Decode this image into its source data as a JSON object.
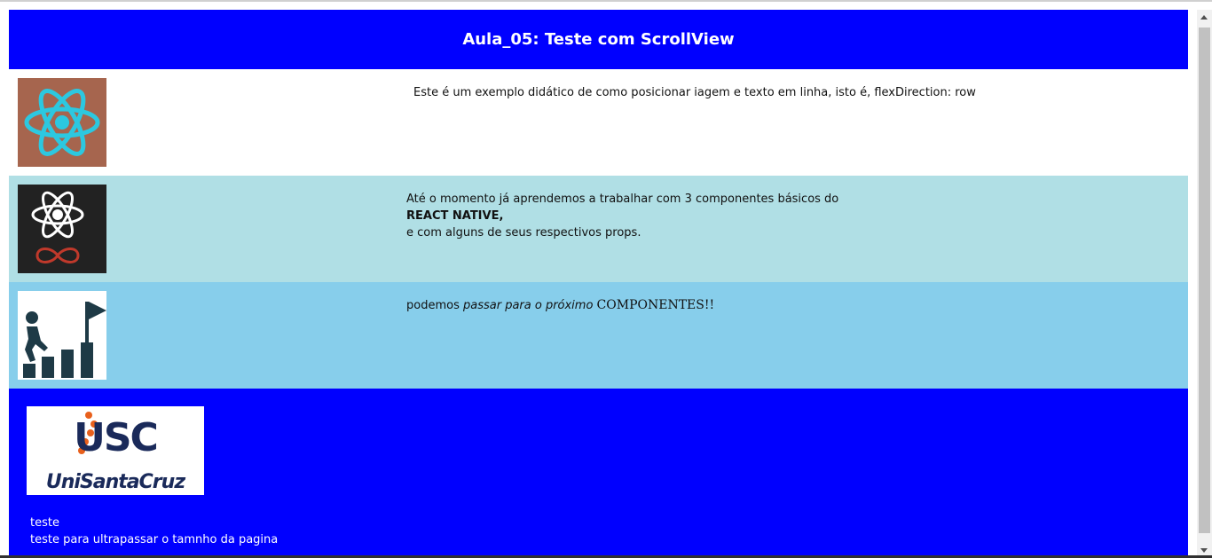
{
  "header": {
    "title": "Aula_05: Teste com ScrollView"
  },
  "rows": [
    {
      "icon": "react-logo-icon",
      "text": "Este é um exemplo didático de como posicionar iagem e texto em linha, isto é, flexDirection: row"
    },
    {
      "icon": "react-native-logo-icon",
      "line1": "Até o momento já aprendemos a trabalhar com 3 componentes básicos do",
      "line2": "REACT NATIVE,",
      "line3": "e com alguns de seus respectivos props."
    },
    {
      "icon": "climbing-stairs-flag-icon",
      "part1": "podemos ",
      "part2": "passar para o próximo ",
      "part3": " COMPONENTES!!"
    }
  ],
  "footer": {
    "logo_text": "UniSantaCruz",
    "logo_mark": "USC",
    "line1": "teste",
    "line2": "teste para ultrapassar o tamnho da pagina"
  },
  "colors": {
    "header_bg": "#0000ff",
    "row2_bg": "#b0dfe5",
    "row3_bg": "#87ceeb",
    "footer_bg": "#0000ff"
  }
}
